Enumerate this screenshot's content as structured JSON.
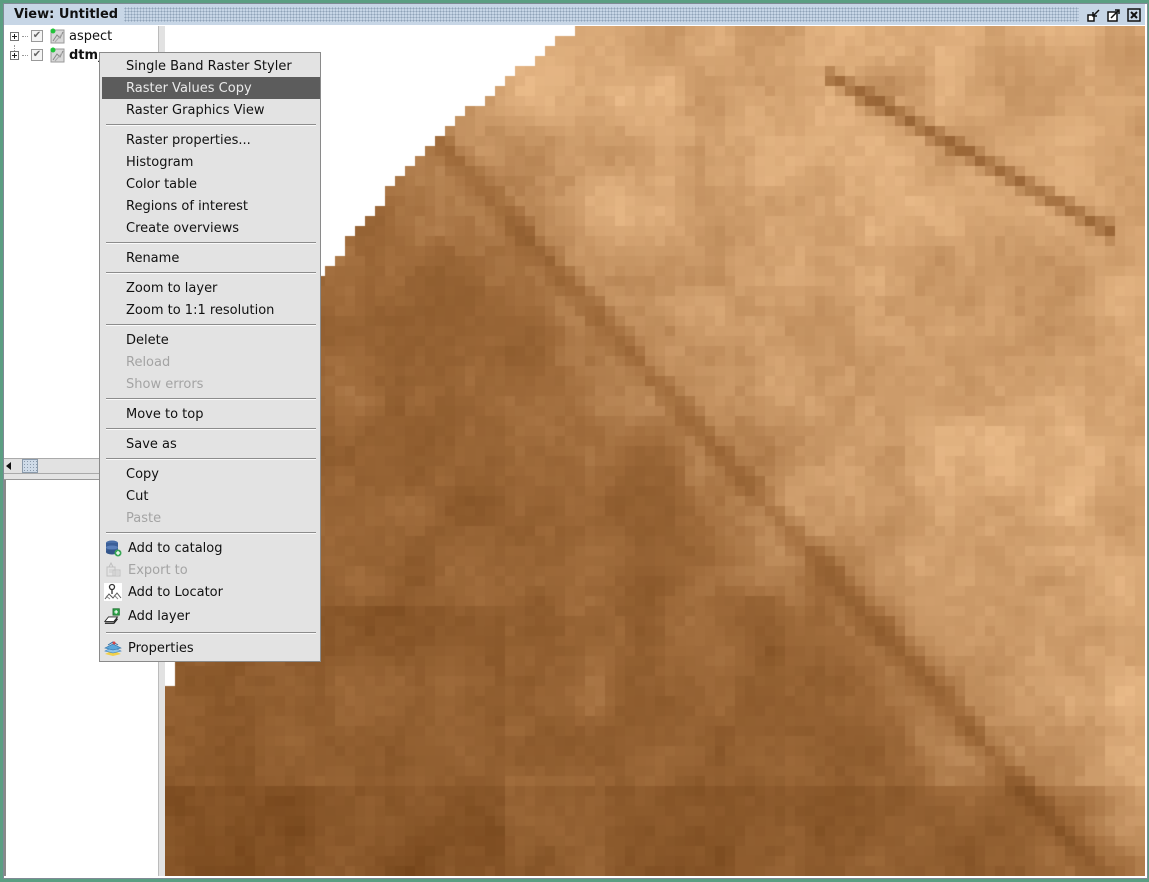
{
  "window": {
    "title": "View: Untitled",
    "buttons": [
      {
        "name": "minimize",
        "icon": "minimize-icon"
      },
      {
        "name": "maximize",
        "icon": "maximize-icon"
      },
      {
        "name": "close",
        "icon": "close-icon"
      }
    ]
  },
  "toc": {
    "layers": [
      {
        "label": "aspect",
        "checked": true,
        "bold": false,
        "icon": "raster-layer-icon"
      },
      {
        "label": "dtm_",
        "checked": true,
        "bold": true,
        "icon": "raster-layer-icon"
      }
    ]
  },
  "context_menu": {
    "groups": [
      [
        {
          "label": "Single Band Raster Styler",
          "state": "normal"
        },
        {
          "label": "Raster Values Copy",
          "state": "selected"
        },
        {
          "label": "Raster Graphics View",
          "state": "normal"
        }
      ],
      [
        {
          "label": "Raster properties...",
          "state": "normal"
        },
        {
          "label": "Histogram",
          "state": "normal"
        },
        {
          "label": "Color table",
          "state": "normal"
        },
        {
          "label": "Regions of interest",
          "state": "normal"
        },
        {
          "label": "Create overviews",
          "state": "normal"
        }
      ],
      [
        {
          "label": "Rename",
          "state": "normal"
        }
      ],
      [
        {
          "label": "Zoom to layer",
          "state": "normal"
        },
        {
          "label": "Zoom to 1:1 resolution",
          "state": "normal"
        }
      ],
      [
        {
          "label": "Delete",
          "state": "normal"
        },
        {
          "label": "Reload",
          "state": "disabled"
        },
        {
          "label": "Show errors",
          "state": "disabled"
        }
      ],
      [
        {
          "label": "Move to top",
          "state": "normal"
        }
      ],
      [
        {
          "label": "Save as",
          "state": "normal"
        }
      ],
      [
        {
          "label": "Copy",
          "state": "normal"
        },
        {
          "label": "Cut",
          "state": "normal"
        },
        {
          "label": "Paste",
          "state": "disabled"
        }
      ],
      [
        {
          "label": "Add to catalog",
          "state": "normal",
          "icon": "database-add-icon"
        },
        {
          "label": "Export to",
          "state": "disabled",
          "icon": "export-icon"
        },
        {
          "label": "Add to Locator",
          "state": "normal",
          "icon": "locator-icon"
        },
        {
          "label": "Add layer",
          "state": "normal",
          "icon": "add-layer-icon"
        }
      ],
      [
        {
          "label": "Properties",
          "state": "normal",
          "icon": "properties-icon"
        }
      ]
    ]
  },
  "map": {
    "layer": "dtm_",
    "palette": {
      "dark": "#5e3008",
      "mid": "#a06c3c",
      "light": "#f6c896"
    }
  }
}
